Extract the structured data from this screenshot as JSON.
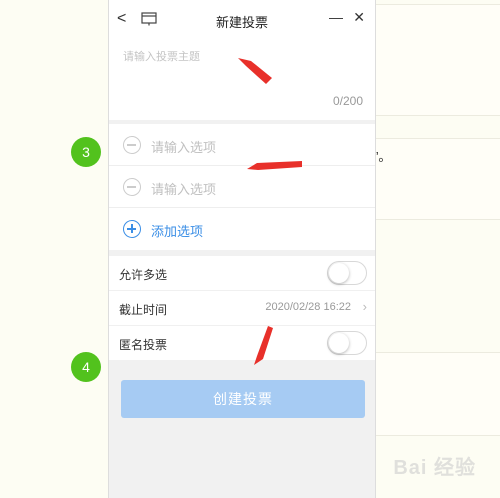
{
  "dialog": {
    "title": "新建投票",
    "back_icon": "<",
    "minimize_icon": "—",
    "close_icon": "✕"
  },
  "topic": {
    "placeholder": "请输入投票主题",
    "counter": "0/200"
  },
  "options": {
    "items": [
      {
        "placeholder": "请输入选项"
      },
      {
        "placeholder": "请输入选项"
      }
    ],
    "add_label": "添加选项"
  },
  "settings": {
    "allow_multiple_label": "允许多选",
    "allow_multiple_on": false,
    "deadline_label": "截止时间",
    "deadline_value": "2020/02/28 16:22",
    "anonymous_label": "匿名投票",
    "anonymous_on": false
  },
  "create_button_label": "创建投票",
  "annotations": {
    "step_badges": [
      "3",
      "4"
    ],
    "background_quote": "”。",
    "watermark": "Bai 经验"
  },
  "colors": {
    "accent": "#3a8ee6",
    "button_disabled": "#a6cbf3",
    "badge": "#52c21d",
    "arrow": "#e8302a"
  }
}
